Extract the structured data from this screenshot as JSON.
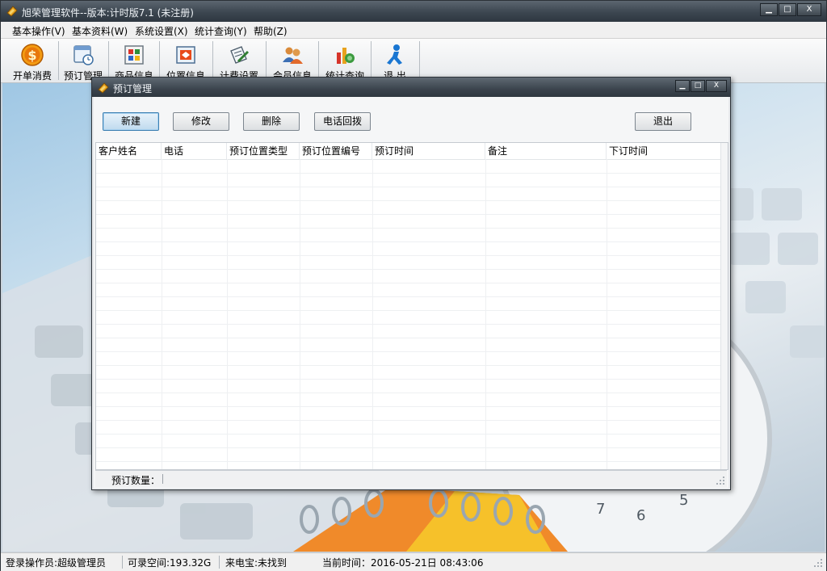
{
  "app": {
    "title": "旭荣管理软件--版本:计时版7.1 (未注册)",
    "window_buttons": {
      "minimize": "▁",
      "maximize": "□",
      "close": "X"
    }
  },
  "menu": [
    {
      "label": "基本操作(V)"
    },
    {
      "label": "基本资料(W)"
    },
    {
      "label": "系统设置(X)"
    },
    {
      "label": "统计查询(Y)"
    },
    {
      "label": "帮助(Z)"
    }
  ],
  "toolbar": [
    {
      "label": "开单消费",
      "icon": "coin-icon"
    },
    {
      "label": "预订管理",
      "icon": "calendar-clock-icon"
    },
    {
      "label": "商品信息",
      "icon": "grid-icon"
    },
    {
      "label": "位置信息",
      "icon": "card-icon"
    },
    {
      "label": "计费设置",
      "icon": "pen-paper-icon"
    },
    {
      "label": "会员信息",
      "icon": "users-icon"
    },
    {
      "label": "统计查询",
      "icon": "chart-icon"
    },
    {
      "label": "退  出",
      "icon": "runner-icon"
    }
  ],
  "dialog": {
    "title": "预订管理",
    "window_buttons": {
      "minimize": "▁",
      "maximize": "□",
      "close": "X"
    },
    "buttons": {
      "new": "新建",
      "edit": "修改",
      "delete": "删除",
      "callback": "电话回拨",
      "exit": "退出"
    },
    "columns": [
      "客户姓名",
      "电话",
      "预订位置类型",
      "预订位置编号",
      "预订时间",
      "备注",
      "下订时间"
    ],
    "rows": [],
    "footer_label": "预订数量："
  },
  "status": {
    "operator": "登录操作员:超级管理员",
    "space": "可录空间:193.32G",
    "caller": "来电宝:未找到",
    "time": "当前时间：2016-05-21日 08:43:06"
  },
  "colors": {
    "title_bar": "#3c4650",
    "accent": "#3c7fb1"
  }
}
